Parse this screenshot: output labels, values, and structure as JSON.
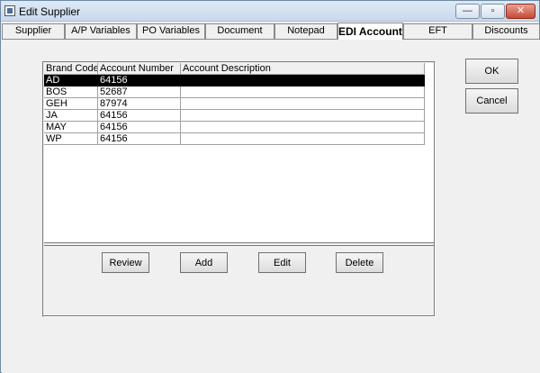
{
  "window": {
    "title": "Edit Supplier",
    "controls": {
      "minimize": "—",
      "maximize": "▫",
      "close": "✕"
    }
  },
  "tabs": [
    {
      "label": "Supplier"
    },
    {
      "label": "A/P Variables"
    },
    {
      "label": "PO Variables"
    },
    {
      "label": "Document"
    },
    {
      "label": "Notepad"
    },
    {
      "label": "EDI Accounts",
      "active": true
    },
    {
      "label": "EFT"
    },
    {
      "label": "Discounts"
    }
  ],
  "grid": {
    "columns": [
      "Brand Code",
      "Account Number",
      "Account Description"
    ],
    "rows": [
      {
        "brand": "AD",
        "account": "64156",
        "description": "",
        "selected": true
      },
      {
        "brand": "BOS",
        "account": "52687",
        "description": ""
      },
      {
        "brand": "GEH",
        "account": "87974",
        "description": ""
      },
      {
        "brand": "JA",
        "account": "64156",
        "description": ""
      },
      {
        "brand": "MAY",
        "account": "64156",
        "description": ""
      },
      {
        "brand": "WP",
        "account": "64156",
        "description": ""
      }
    ]
  },
  "actions": {
    "review": "Review",
    "add": "Add",
    "edit": "Edit",
    "delete": "Delete"
  },
  "dialog": {
    "ok": "OK",
    "cancel": "Cancel"
  }
}
